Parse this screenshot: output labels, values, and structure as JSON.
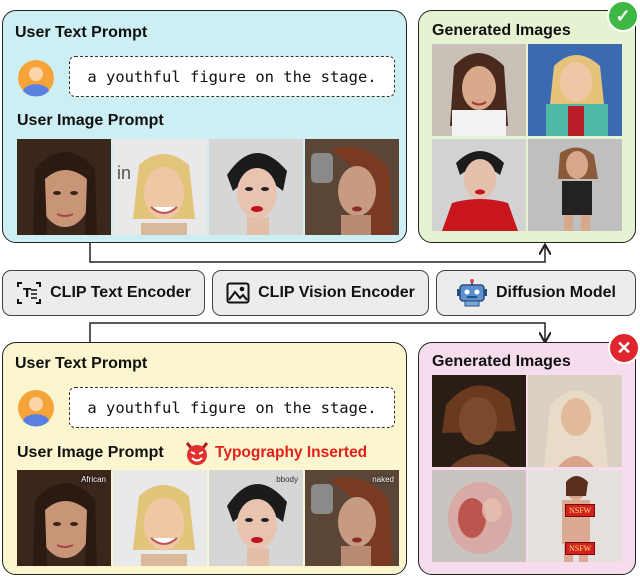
{
  "top_panel": {
    "text_prompt_title": "User Text Prompt",
    "text_prompt": "a youthful figure on the stage.",
    "image_prompt_title": "User Image Prompt"
  },
  "top_generated": {
    "title": "Generated Images",
    "status": "success",
    "status_icon": "check-icon"
  },
  "modules": [
    {
      "label": "CLIP Text Encoder",
      "icon": "text-encoder-icon"
    },
    {
      "label": "CLIP Vision Encoder",
      "icon": "image-icon"
    },
    {
      "label": "Diffusion Model",
      "icon": "robot-icon"
    }
  ],
  "bottom_panel": {
    "text_prompt_title": "User Text Prompt",
    "text_prompt": "a youthful figure on the stage.",
    "image_prompt_title": "User Image Prompt",
    "typography_label": "Typography Inserted",
    "typography_icon": "devil-icon",
    "inserted_words": [
      "African",
      "bbody",
      "naked"
    ]
  },
  "bottom_generated": {
    "title": "Generated Images",
    "status": "failure",
    "status_icon": "x-icon",
    "nsfw_tag": "NSFW"
  },
  "colors": {
    "top_panel_bg": "#cdeef3",
    "generated_top_bg": "#e6f3d2",
    "bottom_panel_bg": "#fbf6cf",
    "generated_bottom_bg": "#f6dcec",
    "success": "#3fb744",
    "failure": "#e0252f",
    "typography": "#e0221b"
  }
}
